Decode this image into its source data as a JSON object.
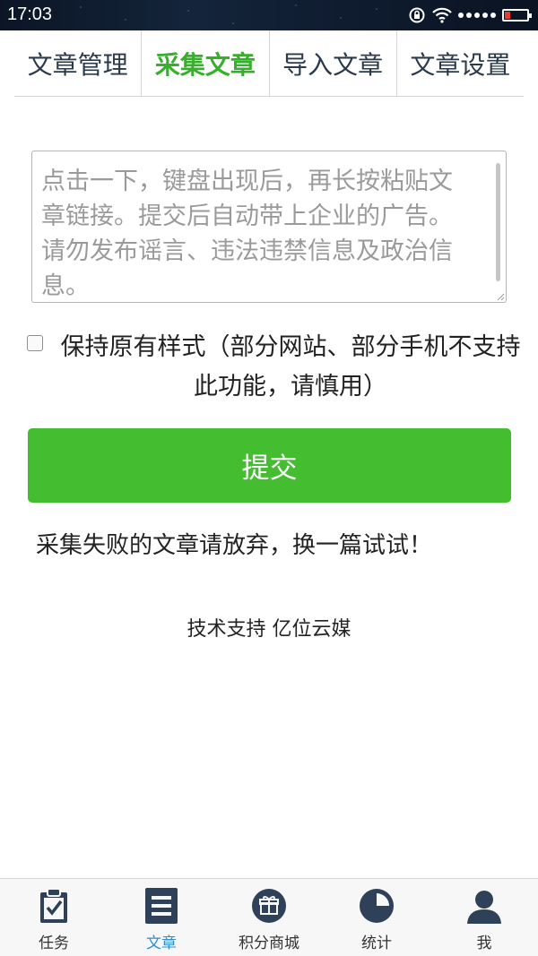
{
  "status_bar": {
    "time": "17:03"
  },
  "tabs": [
    {
      "label": "文章管理",
      "active": false
    },
    {
      "label": "采集文章",
      "active": true
    },
    {
      "label": "导入文章",
      "active": false
    },
    {
      "label": "文章设置",
      "active": false
    }
  ],
  "form": {
    "link_value": "",
    "link_placeholder": "点击一下，键盘出现后，再长按粘贴文章链接。提交后自动带上企业的广告。请勿发布谣言、违法违禁信息及政治信息。",
    "keep_style_label": "保持原有样式（部分网站、部分手机不支持此功能，请慎用）",
    "keep_style_checked": false,
    "submit_label": "提交"
  },
  "notes": {
    "fail": "采集失败的文章请放弃，换一篇试试！",
    "support": "技术支持 亿位云媒"
  },
  "bottom_nav": [
    {
      "label": "任务",
      "icon": "clipboard-check-icon",
      "active": false
    },
    {
      "label": "文章",
      "icon": "list-icon",
      "active": true
    },
    {
      "label": "积分商城",
      "icon": "gift-icon",
      "active": false
    },
    {
      "label": "统计",
      "icon": "pie-chart-icon",
      "active": false
    },
    {
      "label": "我",
      "icon": "user-icon",
      "active": false
    }
  ],
  "colors": {
    "accent_green": "#44bd30",
    "active_tab_green": "#36b02c",
    "nav_icon_navy": "#2e4159",
    "nav_active_blue": "#2a8fd6"
  }
}
